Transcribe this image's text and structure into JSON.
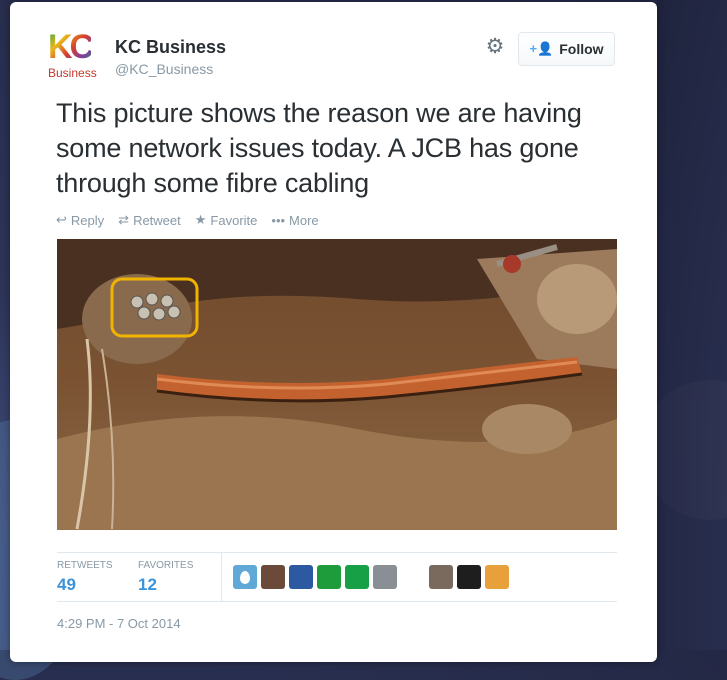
{
  "tweet": {
    "author_name": "KC Business",
    "author_handle": "@KC_Business",
    "logo_text": "KC",
    "logo_subtext": "Business",
    "follow_label": "Follow",
    "text": "This picture shows the reason we are having some network issues today. A JCB has gone through some fibre cabling",
    "timestamp": "4:29 PM - 7 Oct 2014"
  },
  "actions": [
    {
      "label": "Reply",
      "icon": "reply-icon"
    },
    {
      "label": "Retweet",
      "icon": "retweet-icon"
    },
    {
      "label": "Favorite",
      "icon": "star-icon"
    },
    {
      "label": "More",
      "icon": "more-icon"
    }
  ],
  "stats": {
    "retweets_label": "RETWEETS",
    "retweets_value": "49",
    "favorites_label": "FAVORITES",
    "favorites_value": "12"
  },
  "colors": {
    "link_blue": "#3b94d9",
    "follow_icon": "#55acee",
    "muted_text": "#8899a6",
    "main_text": "#292f33"
  },
  "avatars": [
    {
      "icon": "egg-avatar",
      "color": "#5fa8d8"
    },
    {
      "icon": "photo-avatar",
      "color": "#6b4a3a"
    },
    {
      "icon": "landscape-avatar",
      "color": "#2c5aa0"
    },
    {
      "icon": "sign-avatar-green",
      "color": "#1e9b3a"
    },
    {
      "icon": "sign-avatar-green2",
      "color": "#18a047"
    },
    {
      "icon": "photo-avatar-gray",
      "color": "#8a8f96"
    },
    {
      "icon": "crown-avatar",
      "color": "#ffffff"
    },
    {
      "icon": "group-photo-avatar",
      "color": "#7a6a5e"
    },
    {
      "icon": "dark-avatar",
      "color": "#1e1e1e"
    },
    {
      "icon": "badge-avatar",
      "color": "#e8a13a"
    }
  ]
}
